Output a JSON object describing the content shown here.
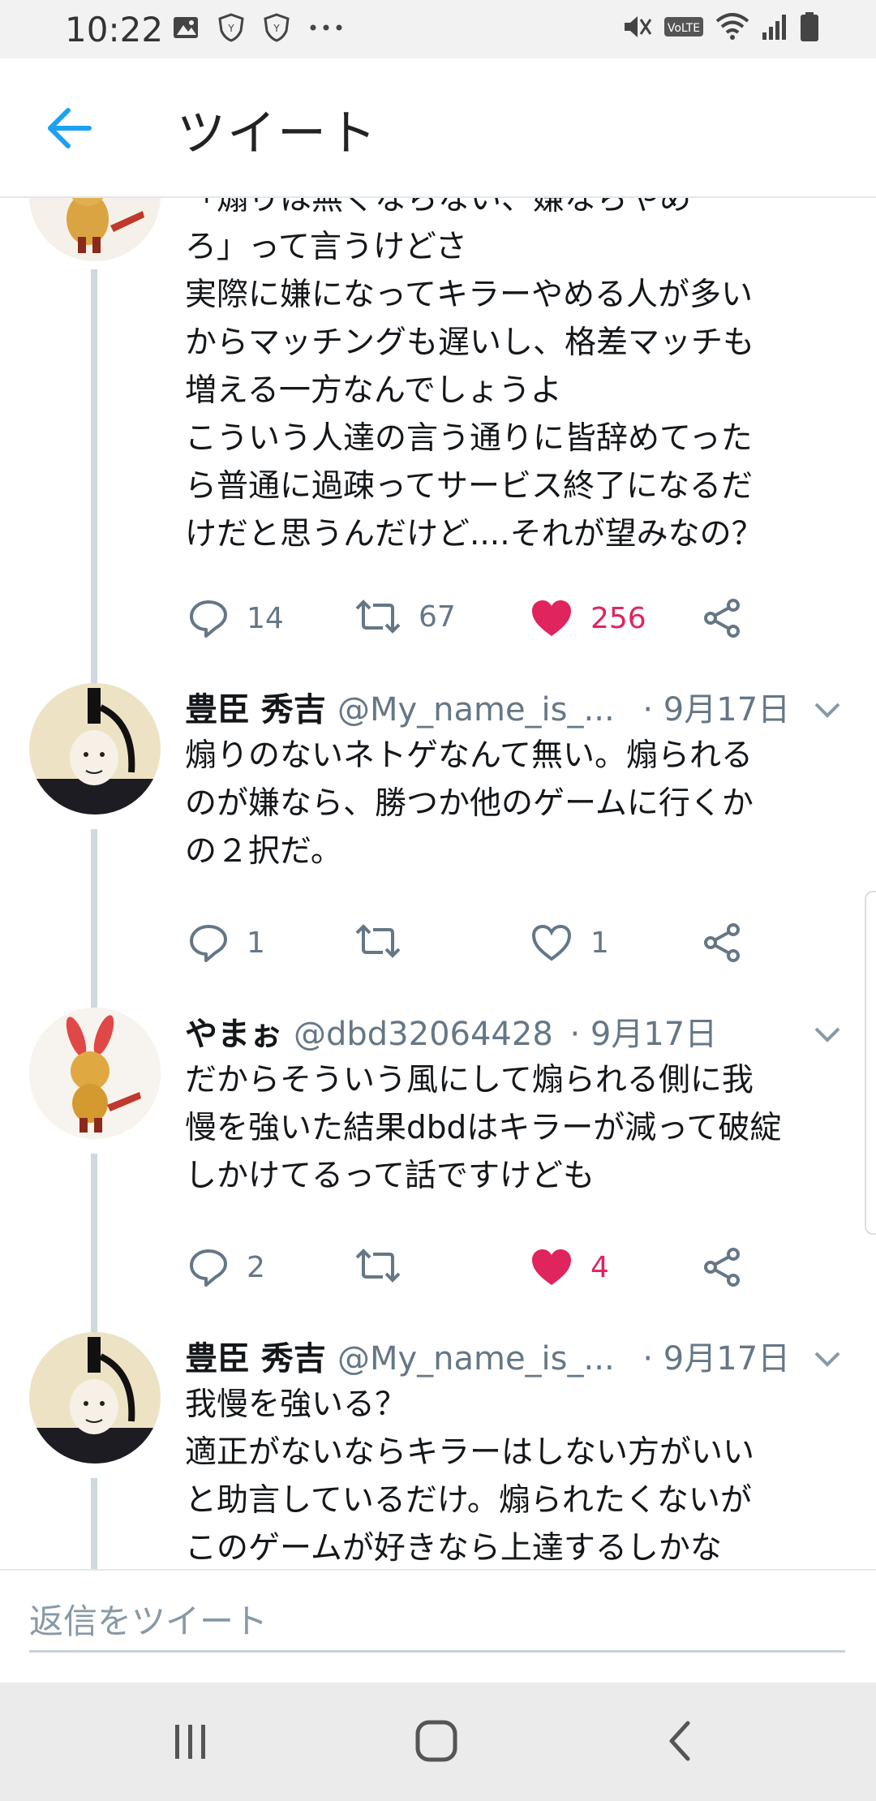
{
  "status_bar": {
    "time": "10:22",
    "left_icons": [
      "gallery-icon",
      "shield-icon",
      "shield-icon",
      "more-icon"
    ],
    "right_icons": [
      "mute-icon",
      "volte-icon",
      "wifi-icon",
      "signal-icon",
      "battery-icon"
    ],
    "volte_label": "VoLTE"
  },
  "header": {
    "back_icon": "arrow-left-icon",
    "title": "ツイート",
    "accent_color": "#1da1f2"
  },
  "tweets": [
    {
      "text_lines": [
        "「煽りは無くならない、嫌ならやめ",
        "ろ」って言うけどさ",
        "実際に嫌になってキラーやめる人が多い",
        "からマッチングも遅いし、格差マッチも",
        "増える一方なんでしょうよ",
        "こういう人達の言う通りに皆辞めてった",
        "ら普通に過疎ってサービス終了になるだ",
        "けだと思うんだけど....それが望みなの？"
      ],
      "replies": "14",
      "retweets": "67",
      "likes": "256",
      "liked": true
    },
    {
      "name": "豊臣 秀吉",
      "handle": "@My_name_is_...",
      "date": "· 9月17日",
      "text_lines": [
        "煽りのないネトゲなんて無い。煽られる",
        "のが嫌なら、勝つか他のゲームに行くか",
        "の２択だ。"
      ],
      "replies": "1",
      "retweets": "",
      "likes": "1",
      "liked": false
    },
    {
      "name": "やまぉ",
      "handle": "@dbd32064428",
      "date": "· 9月17日",
      "text_lines": [
        "だからそういう風にして煽られる側に我",
        "慢を強いた結果dbdはキラーが減って破綻",
        "しかけてるって話ですけども"
      ],
      "replies": "2",
      "retweets": "",
      "likes": "4",
      "liked": true
    },
    {
      "name": "豊臣 秀吉",
      "handle": "@My_name_is_...",
      "date": "· 9月17日",
      "text_lines": [
        "我慢を強いる？",
        "適正がないならキラーはしない方がいい",
        "と助言しているだけ。煽られたくないが",
        "このゲームが好きなら上達するしかな"
      ]
    }
  ],
  "reply_bar": {
    "placeholder": "返信をツイート"
  },
  "nav_bar": {
    "icons": [
      "recent-apps-icon",
      "home-icon",
      "back-icon"
    ]
  },
  "colors": {
    "like_active": "#e0245e",
    "secondary_text": "#657786",
    "thread_line": "#cfd9de"
  }
}
